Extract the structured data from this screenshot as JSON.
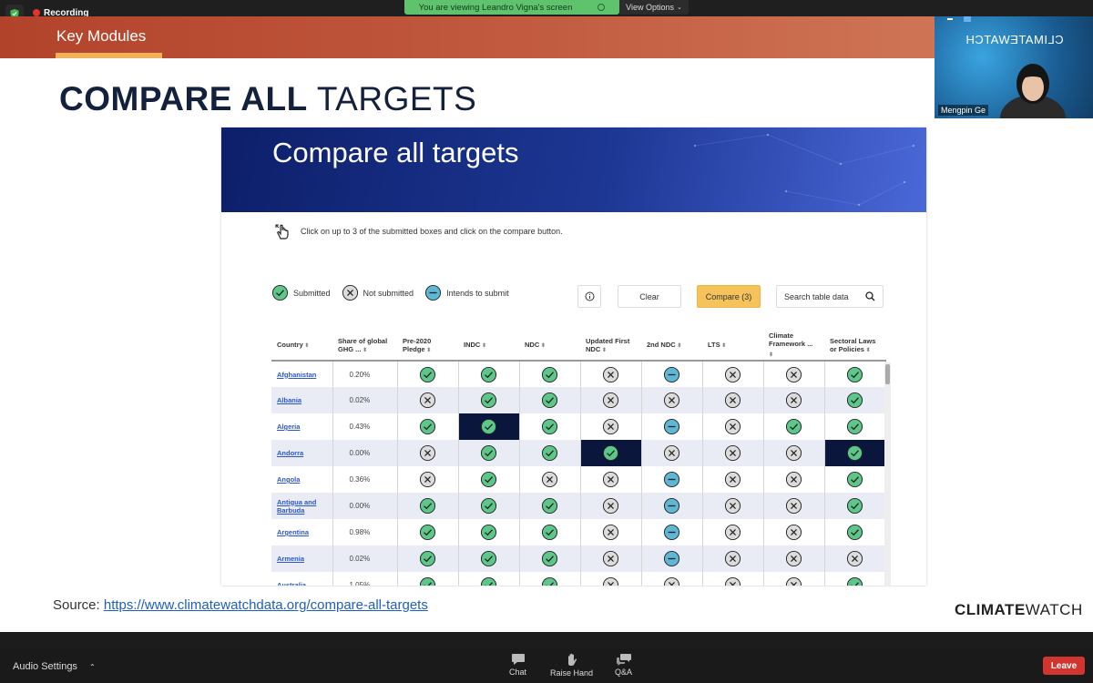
{
  "meeting": {
    "recording_label": "Recording",
    "viewing_label": "You are viewing Leandro Vigna's screen",
    "view_options_label": "View Options",
    "participant_name": "Mengpin Ge",
    "video_watermark": "CLIMATEWATCH"
  },
  "slide": {
    "header_tab": "Key Modules",
    "title_bold": "COMPARE ALL",
    "title_light": "TARGETS",
    "source_label": "Source:",
    "source_link": "https://www.climatewatchdata.org/compare-all-targets",
    "brand_bold": "CLIMATE",
    "brand_light": "WATCH"
  },
  "embed": {
    "hero_title": "Compare all targets",
    "instruction": "Click on up to 3 of the submitted boxes and click on the compare button.",
    "legend": {
      "submitted": "Submitted",
      "not_submitted": "Not submitted",
      "intends": "Intends to submit"
    },
    "clear_label": "Clear",
    "compare_label": "Compare (3)",
    "search_placeholder": "Search table data",
    "columns": [
      "Country",
      "Share of global GHG ...",
      "Pre-2020 Pledge",
      "INDC",
      "NDC",
      "Updated First NDC",
      "2nd NDC",
      "LTS",
      "Climate Framework ...",
      "Sectoral Laws or Policies"
    ],
    "rows": [
      {
        "country": "Afghanistan",
        "share": "0.20%",
        "status": [
          "s",
          "s",
          "s",
          "x",
          "i",
          "x",
          "x",
          "s"
        ]
      },
      {
        "country": "Albania",
        "share": "0.02%",
        "status": [
          "x",
          "s",
          "s",
          "x",
          "x",
          "x",
          "x",
          "s"
        ]
      },
      {
        "country": "Algeria",
        "share": "0.43%",
        "status": [
          "s",
          "s",
          "s",
          "x",
          "i",
          "x",
          "s",
          "s"
        ]
      },
      {
        "country": "Andorra",
        "share": "0.00%",
        "status": [
          "x",
          "s",
          "s",
          "s",
          "x",
          "x",
          "x",
          "s"
        ]
      },
      {
        "country": "Angola",
        "share": "0.36%",
        "status": [
          "x",
          "s",
          "x",
          "x",
          "i",
          "x",
          "x",
          "s"
        ]
      },
      {
        "country": "Antigua and Barbuda",
        "share": "0.00%",
        "status": [
          "s",
          "s",
          "s",
          "x",
          "i",
          "x",
          "x",
          "s"
        ]
      },
      {
        "country": "Argentina",
        "share": "0.98%",
        "status": [
          "s",
          "s",
          "s",
          "x",
          "i",
          "x",
          "x",
          "s"
        ]
      },
      {
        "country": "Armenia",
        "share": "0.02%",
        "status": [
          "s",
          "s",
          "s",
          "x",
          "i",
          "x",
          "x",
          "x"
        ]
      },
      {
        "country": "Australia",
        "share": "1.05%",
        "status": [
          "s",
          "s",
          "s",
          "x",
          "x",
          "x",
          "x",
          "s"
        ]
      }
    ],
    "selected_cells": [
      [
        2,
        1
      ],
      [
        3,
        3
      ],
      [
        3,
        7
      ]
    ]
  },
  "toolbar": {
    "audio_settings": "Audio Settings",
    "chat": "Chat",
    "raise_hand": "Raise Hand",
    "qa": "Q&A",
    "leave": "Leave"
  }
}
